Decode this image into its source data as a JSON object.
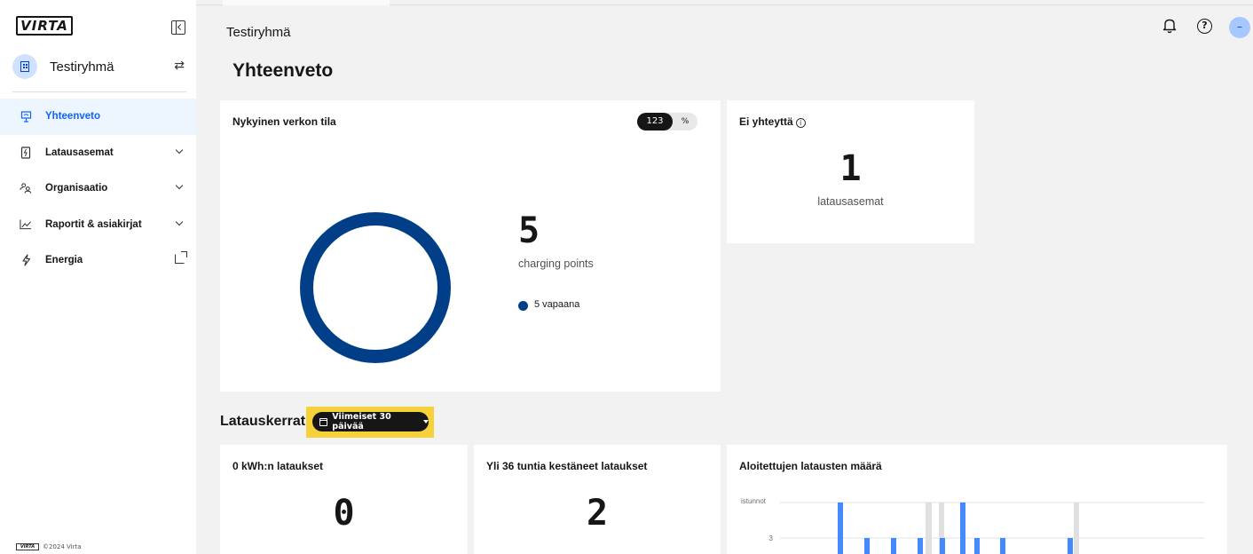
{
  "app": {
    "logo_text": "VIRTA",
    "footer_logo": "VIRTA",
    "footer_text": "©2024 Virta"
  },
  "sidebar": {
    "org_name": "Testiryhmä",
    "items": [
      {
        "label": "Yhteenveto",
        "icon": "presentation-icon",
        "active": true,
        "expandable": false
      },
      {
        "label": "Latausasemat",
        "icon": "charger-icon",
        "active": false,
        "expandable": true
      },
      {
        "label": "Organisaatio",
        "icon": "users-icon",
        "active": false,
        "expandable": true
      },
      {
        "label": "Raportit & asiakirjat",
        "icon": "chart-line-icon",
        "active": false,
        "expandable": true
      },
      {
        "label": "Energia",
        "icon": "lightning-icon",
        "active": false,
        "external": true
      }
    ]
  },
  "header": {
    "breadcrumb": "Testiryhmä",
    "title": "Yhteenveto",
    "user_initial": "–",
    "help_glyph": "?"
  },
  "network_card": {
    "title": "Nykyinen verkon tila",
    "toggle_count": "123",
    "toggle_percent": "%",
    "total": "5",
    "total_label": "charging points",
    "legend": "5 vapaana",
    "free_color": "#003f87"
  },
  "offline_card": {
    "title": "Ei yhteyttä",
    "info": "i",
    "value": "1",
    "label": "latausasemat"
  },
  "sessions": {
    "title": "Latauskerrat",
    "range": "Viimeiset 30 päivää",
    "zero_kwh": {
      "title": "0 kWh:n lataukset",
      "value": "0"
    },
    "over_36h": {
      "title": "Yli 36 tuntia kestäneet lataukset",
      "value": "2"
    }
  },
  "chart_data": {
    "type": "bar",
    "title": "Aloitettujen latausten määrä",
    "ylabel": "istunnot",
    "yticks": [
      3
    ],
    "ylim": [
      0,
      4
    ],
    "series": [
      {
        "values": [
          4,
          3,
          3,
          3,
          3,
          4,
          3,
          3,
          3
        ],
        "color": "#4589ff"
      }
    ],
    "highlight_series_color": "#e0e0e0"
  }
}
